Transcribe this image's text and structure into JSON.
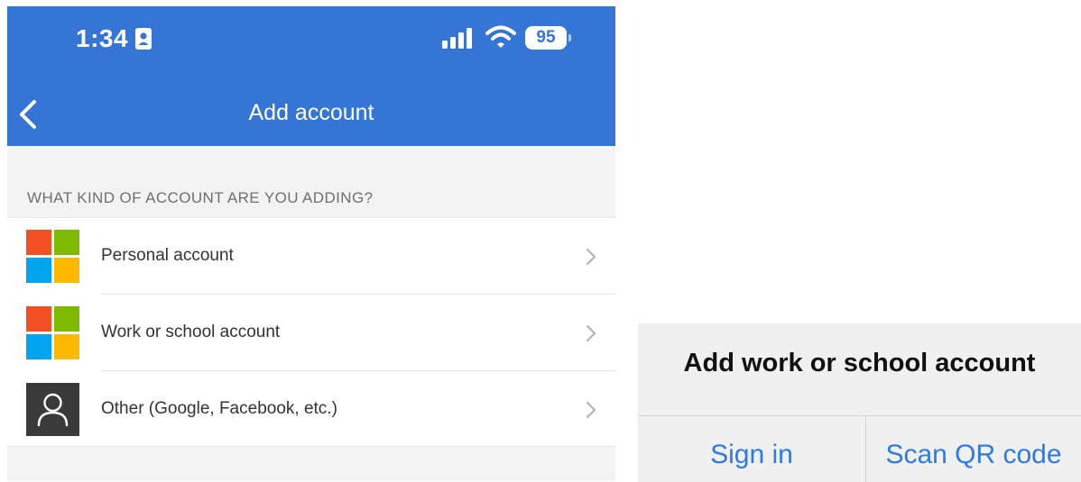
{
  "status_bar": {
    "time": "1:34",
    "battery": "95"
  },
  "nav": {
    "title": "Add account"
  },
  "section_header": "WHAT KIND OF ACCOUNT ARE YOU ADDING?",
  "accounts": [
    {
      "label": "Personal account",
      "icon": "microsoft-logo-icon"
    },
    {
      "label": "Work or school account",
      "icon": "microsoft-logo-icon"
    },
    {
      "label": "Other (Google, Facebook, etc.)",
      "icon": "person-icon"
    }
  ],
  "dialog": {
    "title": "Add work or school account",
    "sign_in": "Sign in",
    "scan_qr": "Scan QR code"
  },
  "colors": {
    "header_blue": "#3475d6",
    "link_blue": "#2f7ae5",
    "ms_red": "#f25022",
    "ms_green": "#7fba00",
    "ms_blue": "#00a4ef",
    "ms_yellow": "#ffb900"
  }
}
